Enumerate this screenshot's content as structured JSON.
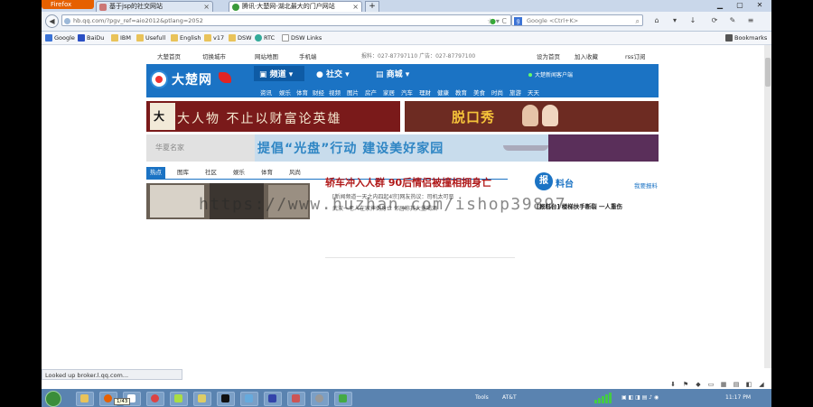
{
  "browser": {
    "firefox_label": "Firefox",
    "tabs": [
      {
        "title": "基于jsp的社交网站"
      },
      {
        "title": "腾讯·大楚网-湖北最大的门户网站"
      }
    ],
    "new_tab": "+",
    "url": "hb.qq.com/?pgv_ref=aio2012&ptlang=2052",
    "search_placeholder": "Google <Ctrl+K>",
    "search_engine": "g",
    "bookmarks": [
      {
        "label": "Google",
        "icon": "google-icon"
      },
      {
        "label": "BaiDu",
        "icon": "baidu-icon"
      },
      {
        "label": "IBM",
        "icon": "folder-icon"
      },
      {
        "label": "Usefull",
        "icon": "folder-icon"
      },
      {
        "label": "English",
        "icon": "folder-icon"
      },
      {
        "label": "v17",
        "icon": "folder-icon"
      },
      {
        "label": "DSW",
        "icon": "folder-icon"
      },
      {
        "label": "RTC",
        "icon": "rtc-icon"
      },
      {
        "label": "DSW Links",
        "icon": "folder-icon"
      }
    ],
    "bookmarks_menu": "Bookmarks",
    "status_text": "Looked up broker.l.qq.com..."
  },
  "site": {
    "top_links": {
      "home": "大楚首页",
      "switch_city": "切换城市",
      "site_nav": "网站地图",
      "mobile": "手机端",
      "phone": "报料：027-87797110 广告：027-87797100",
      "set_home": "设为首页",
      "add_fav": "加入收藏",
      "rss": "rss订阅"
    },
    "logo_text": "大楚网",
    "channels": [
      "频道",
      "社交",
      "商城"
    ],
    "sub_nav": [
      "资讯",
      "娱乐",
      "体育",
      "财经",
      "视频",
      "图片",
      "房产",
      "家居",
      "汽车",
      "理财",
      "健康",
      "教育",
      "美食",
      "时尚",
      "旅游",
      "天天"
    ],
    "header_news": "大楚新闻客户端",
    "banner1": {
      "ink": "大",
      "text": "大人物  不止以财富论英雄"
    },
    "banner2": {
      "text": "脱口秀"
    },
    "banner3": {
      "left": "华夏名家",
      "text": "提倡“光盘”行动 建设美好家园"
    },
    "news_tabs": [
      "热点",
      "图库",
      "社区",
      "娱乐",
      "体育",
      "风尚"
    ],
    "headline": "轿车冲入人群 90后情侣被撞相拥身亡",
    "subline": "[新闻频道一天之内四起4宗]网友热议：司机太可恶",
    "subline2": "武汉一老人在家摔倒身亡 邻居称其大量喝酒",
    "baoliao": {
      "circle": "报",
      "title": "料台",
      "link": "我要报料",
      "item": "[报料台] 楼梯扶手断裂 一人重伤"
    },
    "watermark": "https://www.huzhan.com/ishop39897"
  },
  "taskbar": {
    "tools": "Tools",
    "carrier": "AT&T",
    "clock": "11:17 PM",
    "tooltip": "1/43"
  }
}
